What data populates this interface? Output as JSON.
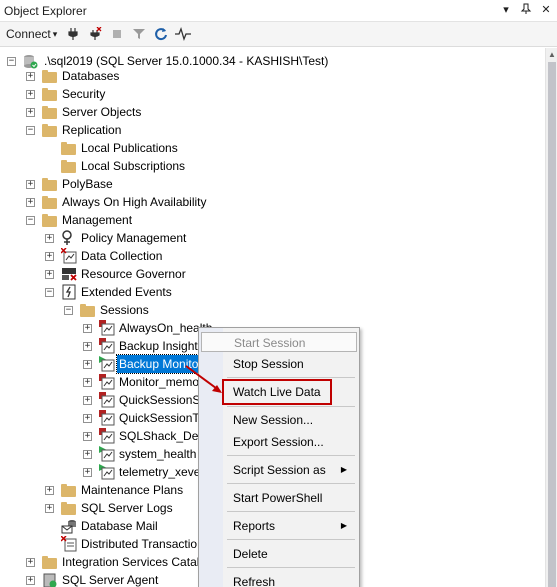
{
  "panel": {
    "title": "Object Explorer",
    "pin_glyph": "▾",
    "pin2_glyph": "⊓",
    "close_glyph": "✕"
  },
  "toolbar": {
    "connect_label": "Connect",
    "connect_arrow": "▾"
  },
  "tree": {
    "server": ".\\sql2019 (SQL Server 15.0.1000.34 - KASHISH\\Test)",
    "databases": "Databases",
    "security": "Security",
    "server_objects": "Server Objects",
    "replication": "Replication",
    "local_publications": "Local Publications",
    "local_subscriptions": "Local Subscriptions",
    "polybase": "PolyBase",
    "always_on": "Always On High Availability",
    "management": "Management",
    "policy_management": "Policy Management",
    "data_collection": "Data Collection",
    "resource_governor": "Resource Governor",
    "extended_events": "Extended Events",
    "sessions": "Sessions",
    "session_items": [
      "AlwaysOn_health",
      "Backup Insight",
      "Backup Monito",
      "Monitor_memo",
      "QuickSessionS",
      "QuickSessionT",
      "SQLShack_Dem",
      "system_health",
      "telemetry_xeve"
    ],
    "maintenance_plans": "Maintenance Plans",
    "sql_server_logs": "SQL Server Logs",
    "database_mail": "Database Mail",
    "distributed_transactions": "Distributed Transactio",
    "integration_services": "Integration Services Catalo",
    "sql_server_agent": "SQL Server Agent"
  },
  "context_menu": {
    "start_session": "Start Session",
    "stop_session": "Stop Session",
    "watch_live_data": "Watch Live Data",
    "new_session": "New Session...",
    "export_session": "Export Session...",
    "script_session_as": "Script Session as",
    "start_powershell": "Start PowerShell",
    "reports": "Reports",
    "delete": "Delete",
    "refresh": "Refresh",
    "submenu_arrow": "▶"
  },
  "colors": {
    "selection": "#0078d7",
    "folder": "#dcb66a",
    "highlight": "#c00000"
  }
}
